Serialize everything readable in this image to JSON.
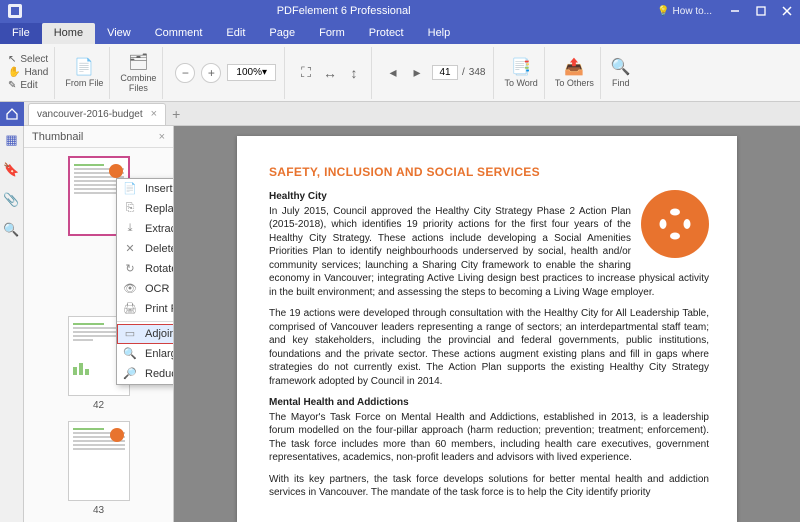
{
  "title": "PDFelement 6 Professional",
  "howto": "How to...",
  "menu": {
    "file": "File",
    "home": "Home",
    "view": "View",
    "comment": "Comment",
    "edit": "Edit",
    "page": "Page",
    "form": "Form",
    "protect": "Protect",
    "help": "Help"
  },
  "ribbon": {
    "select": "Select",
    "hand": "Hand",
    "edit": "Edit",
    "fromfile": "From File",
    "combine": "Combine\nFiles",
    "zoom": "100%",
    "page_current": "41",
    "page_total": "348",
    "toword": "To Word",
    "toothers": "To Others",
    "find": "Find"
  },
  "tab": {
    "name": "vancouver-2016-budget"
  },
  "thumbnail": {
    "title": "Thumbnail",
    "labels": [
      "42",
      "43"
    ]
  },
  "context_menu": {
    "items": [
      "Insert Page",
      "Replace Page",
      "Extract Page",
      "Delete Page",
      "Rotate Page",
      "OCR Page",
      "Print Page",
      "Adjoin all pages into one single image",
      "Enlarge Page Thumbnails",
      "Reduce Page Thumbnails"
    ]
  },
  "document": {
    "heading": "SAFETY, INCLUSION AND SOCIAL SERVICES",
    "h1": "Healthy City",
    "p1": "In July 2015, Council approved the Healthy City Strategy Phase 2 Action Plan (2015-2018), which identifies 19 priority actions for the first four years of the Healthy City Strategy. These actions include developing a Social Amenities Priorities Plan to identify neighbourhoods underserved by social, health and/or community services; launching a Sharing City framework to enable the sharing economy in Vancouver; integrating Active Living design best practices to increase physical activity in the built environment; and assessing the steps to becoming a Living Wage employer.",
    "p2": "The 19 actions were developed through consultation with the Healthy City for All Leadership Table, comprised of Vancouver leaders representing a range of sectors; an interdepartmental staff team; and key stakeholders, including the provincial and federal governments, public institutions, foundations and the private sector. These actions augment existing plans and fill in gaps where strategies do not currently exist. The Action Plan supports the existing Healthy City Strategy framework adopted by Council in 2014.",
    "h2": "Mental Health and Addictions",
    "p3": "The Mayor's Task Force on Mental Health and Addictions, established in 2013, is a leadership forum modelled on the four-pillar approach (harm reduction; prevention; treatment; enforcement). The task force includes more than 60 members, including health care executives, government representatives, academics, non-profit leaders and advisors with lived experience.",
    "p4": "With its key partners, the task force develops solutions for better mental health and addiction services in Vancouver. The mandate of the task force is to help the City identify priority"
  }
}
